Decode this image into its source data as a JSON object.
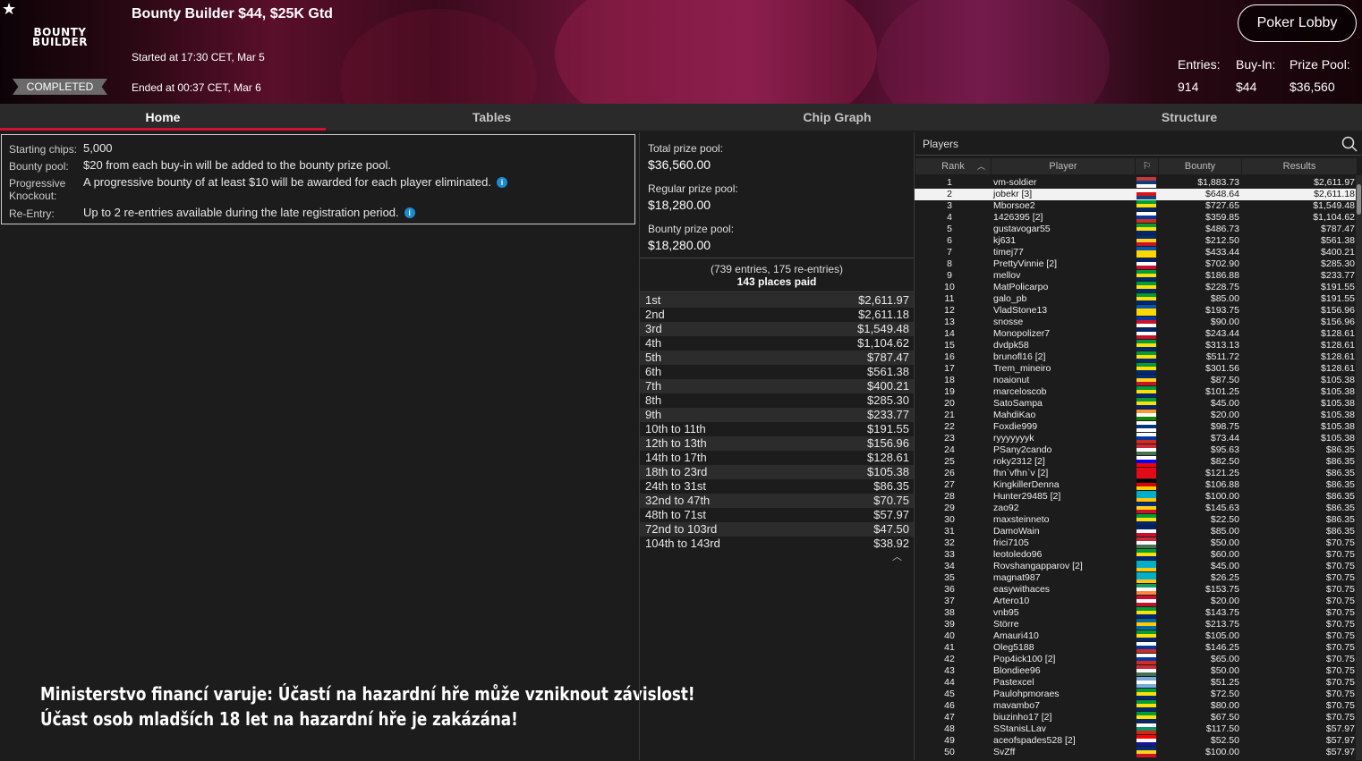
{
  "header": {
    "logo_line1": "BOUNTY",
    "logo_line2": "BUILDER",
    "status": "COMPLETED",
    "title": "Bounty Builder $44, $25K Gtd",
    "started": "Started at 17:30 CET, Mar 5",
    "ended": "Ended at 00:37 CET, Mar 6",
    "lobby_button": "Poker Lobby",
    "entries_label": "Entries:",
    "entries_value": "914",
    "buyin_label": "Buy-In:",
    "buyin_value": "$44",
    "prizepool_label": "Prize Pool:",
    "prizepool_value": "$36,560"
  },
  "tabs": [
    "Home",
    "Tables",
    "Chip Graph",
    "Structure"
  ],
  "info": [
    {
      "label": "Starting chips:",
      "value": "5,000",
      "icon": false
    },
    {
      "label": "Bounty pool:",
      "value": "$20 from each buy-in will be added to the bounty prize pool.",
      "icon": false
    },
    {
      "label": "Progressive Knockout:",
      "value": "A progressive bounty of at least $10 will be awarded for each player eliminated.",
      "icon": true
    },
    {
      "label": "Re-Entry:",
      "value": "Up to 2 re-entries available during the late registration period.",
      "icon": true
    }
  ],
  "warning": {
    "line1": "Ministerstvo financí varuje: Účastí na hazardní hře může vzniknout závislost!",
    "line2": "Účast osob mladších 18 let na hazardní hře je zakázána!"
  },
  "prizes": {
    "total_label": "Total prize pool:",
    "total_value": "$36,560.00",
    "regular_label": "Regular prize pool:",
    "regular_value": "$18,280.00",
    "bounty_label": "Bounty prize pool:",
    "bounty_value": "$18,280.00",
    "entries_note": "(739 entries, 175 re-entries)",
    "places_paid": "143 places paid"
  },
  "payouts": [
    [
      "1st",
      "$2,611.97"
    ],
    [
      "2nd",
      "$2,611.18"
    ],
    [
      "3rd",
      "$1,549.48"
    ],
    [
      "4th",
      "$1,104.62"
    ],
    [
      "5th",
      "$787.47"
    ],
    [
      "6th",
      "$561.38"
    ],
    [
      "7th",
      "$400.21"
    ],
    [
      "8th",
      "$285.30"
    ],
    [
      "9th",
      "$233.77"
    ],
    [
      "10th to 11th",
      "$191.55"
    ],
    [
      "12th to 13th",
      "$156.96"
    ],
    [
      "14th to 17th",
      "$128.61"
    ],
    [
      "18th to 23rd",
      "$105.38"
    ],
    [
      "24th to 31st",
      "$86.35"
    ],
    [
      "32nd to 47th",
      "$70.75"
    ],
    [
      "48th to 71st",
      "$57.97"
    ],
    [
      "72nd to 103rd",
      "$47.50"
    ],
    [
      "104th to 143rd",
      "$38.92"
    ]
  ],
  "players_panel": {
    "title": "Players",
    "columns": {
      "rank": "Rank",
      "player": "Player",
      "bounty": "Bounty",
      "results": "Results"
    }
  },
  "flag_colors": {
    "rs": [
      "#c6363c",
      "#0c4076",
      "#ffffff"
    ],
    "cz": [
      "#ffffff",
      "#d7141a",
      "#11457e"
    ],
    "br": [
      "#009c3b",
      "#ffdf00",
      "#002776"
    ],
    "ro": [
      "#002b7f",
      "#fcd116",
      "#ce1126"
    ],
    "gb": [
      "#012169",
      "#ffffff",
      "#c8102e"
    ],
    "ua": [
      "#0057b7",
      "#ffd700",
      "#ffd700"
    ],
    "ph": [
      "#0038a8",
      "#ce1126",
      "#ffffff"
    ],
    "in": [
      "#ff9933",
      "#ffffff",
      "#138808"
    ],
    "fi": [
      "#ffffff",
      "#003580",
      "#ffffff"
    ],
    "ru": [
      "#ffffff",
      "#0039a6",
      "#d52b1e"
    ],
    "hu": [
      "#ce2939",
      "#ffffff",
      "#477050"
    ],
    "si": [
      "#ffffff",
      "#0000ff",
      "#ff0000"
    ],
    "tr": [
      "#e30a17",
      "#e30a17",
      "#e30a17"
    ],
    "de": [
      "#000000",
      "#dd0000",
      "#ffce00"
    ],
    "kz": [
      "#00afca",
      "#00afca",
      "#fec50c"
    ],
    "dk": [
      "#c8102e",
      "#ffffff",
      "#c8102e"
    ],
    "ie": [
      "#169b62",
      "#ffffff",
      "#ff883e"
    ],
    "se": [
      "#006aa7",
      "#fecc00",
      "#006aa7"
    ],
    "bg": [
      "#ffffff",
      "#00966e",
      "#d62612"
    ],
    "ar": [
      "#74acdf",
      "#ffffff",
      "#74acdf"
    ],
    "hr": [
      "#ff0000",
      "#ffffff",
      "#171796"
    ]
  },
  "players": [
    [
      "1",
      "vm-soldier",
      "rs",
      "$1,883.73",
      "$2,611.97"
    ],
    [
      "2",
      "jobekr [3]",
      "cz",
      "$648.64",
      "$2,611.18"
    ],
    [
      "3",
      "Mborsoe2",
      "br",
      "$727.65",
      "$1,549.48"
    ],
    [
      "4",
      "1426395 [2]",
      "ru",
      "$359.85",
      "$1,104.62"
    ],
    [
      "5",
      "gustavogar55",
      "br",
      "$486.73",
      "$787.47"
    ],
    [
      "6",
      "kj631",
      "ro",
      "$212.50",
      "$561.38"
    ],
    [
      "7",
      "timej77",
      "ua",
      "$433.44",
      "$400.21"
    ],
    [
      "8",
      "PrettyVinnie [2]",
      "gb",
      "$702.90",
      "$285.30"
    ],
    [
      "9",
      "mellov",
      "br",
      "$186.88",
      "$233.77"
    ],
    [
      "10",
      "MatPolicarpo",
      "br",
      "$228.75",
      "$191.55"
    ],
    [
      "11",
      "galo_pb",
      "br",
      "$85.00",
      "$191.55"
    ],
    [
      "12",
      "VladStone13",
      "ua",
      "$193.75",
      "$156.96"
    ],
    [
      "13",
      "snosse",
      "ph",
      "$90.00",
      "$156.96"
    ],
    [
      "14",
      "Monopolizer7",
      "gb",
      "$243.44",
      "$128.61"
    ],
    [
      "15",
      "dvdpk58",
      "br",
      "$313.13",
      "$128.61"
    ],
    [
      "16",
      "brunofl16 [2]",
      "br",
      "$511.72",
      "$128.61"
    ],
    [
      "17",
      "Trem_mineiro",
      "br",
      "$301.56",
      "$128.61"
    ],
    [
      "18",
      "noaionut",
      "ro",
      "$87.50",
      "$105.38"
    ],
    [
      "19",
      "marceloscob",
      "br",
      "$101.25",
      "$105.38"
    ],
    [
      "20",
      "SatoSampa",
      "br",
      "$45.00",
      "$105.38"
    ],
    [
      "21",
      "MahdiKao",
      "in",
      "$20.00",
      "$105.38"
    ],
    [
      "22",
      "Foxdie999",
      "fi",
      "$98.75",
      "$105.38"
    ],
    [
      "23",
      "ryyyyyyyk",
      "ru",
      "$73.44",
      "$105.38"
    ],
    [
      "24",
      "PSany2cando",
      "hu",
      "$95.63",
      "$86.35"
    ],
    [
      "25",
      "roky2312 [2]",
      "si",
      "$82.50",
      "$86.35"
    ],
    [
      "26",
      "fhn`vfhn`v [2]",
      "tr",
      "$121.25",
      "$86.35"
    ],
    [
      "27",
      "KingkillerDenna",
      "de",
      "$106.88",
      "$86.35"
    ],
    [
      "28",
      "Hunter29485 [2]",
      "kz",
      "$100.00",
      "$86.35"
    ],
    [
      "29",
      "zao92",
      "ro",
      "$145.63",
      "$86.35"
    ],
    [
      "30",
      "maxsteinneto",
      "br",
      "$22.50",
      "$86.35"
    ],
    [
      "31",
      "DamoWain",
      "gb",
      "$85.00",
      "$86.35"
    ],
    [
      "32",
      "frici7105",
      "hu",
      "$50.00",
      "$70.75"
    ],
    [
      "33",
      "leotoledo96",
      "br",
      "$60.00",
      "$70.75"
    ],
    [
      "34",
      "Rovshangapparov [2]",
      "kz",
      "$45.00",
      "$70.75"
    ],
    [
      "35",
      "magnat987",
      "kz",
      "$26.25",
      "$70.75"
    ],
    [
      "36",
      "easywithaces",
      "ie",
      "$153.75",
      "$70.75"
    ],
    [
      "37",
      "Artero10",
      "dk",
      "$20.00",
      "$70.75"
    ],
    [
      "38",
      "vnb95",
      "br",
      "$143.75",
      "$70.75"
    ],
    [
      "39",
      "Större",
      "se",
      "$213.75",
      "$70.75"
    ],
    [
      "40",
      "Amauri410",
      "br",
      "$105.00",
      "$70.75"
    ],
    [
      "41",
      "Oleg5188",
      "ru",
      "$146.25",
      "$70.75"
    ],
    [
      "42",
      "Pop4ick100 [2]",
      "ru",
      "$65.00",
      "$70.75"
    ],
    [
      "43",
      "Blondiee96",
      "hu",
      "$50.00",
      "$70.75"
    ],
    [
      "44",
      "Pastexcel",
      "ar",
      "$51.25",
      "$70.75"
    ],
    [
      "45",
      "Paulohpmoraes",
      "br",
      "$72.50",
      "$70.75"
    ],
    [
      "46",
      "mavambo7",
      "br",
      "$80.00",
      "$70.75"
    ],
    [
      "47",
      "biuzinho17 [2]",
      "br",
      "$67.50",
      "$70.75"
    ],
    [
      "48",
      "SStanisLLav",
      "bg",
      "$117.50",
      "$57.97"
    ],
    [
      "49",
      "aceofspades528 [2]",
      "hr",
      "$52.50",
      "$57.97"
    ],
    [
      "50",
      "SvZff",
      "ro",
      "$100.00",
      "$57.97"
    ]
  ]
}
